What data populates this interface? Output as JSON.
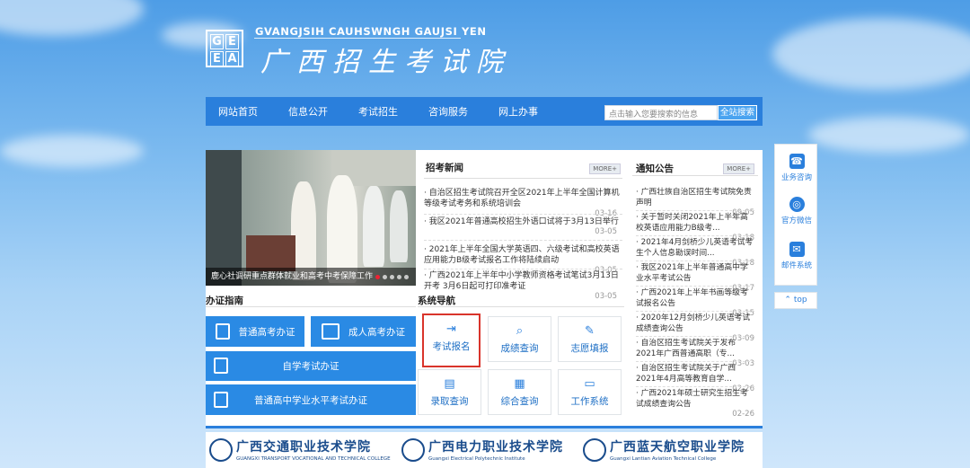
{
  "header": {
    "logo_letters": [
      "G",
      "E",
      "E",
      "A"
    ],
    "org_en": "GVANGJSIH CAUHSWNGH GAUJSI YEN",
    "org_cn": "广西招生考试院"
  },
  "nav": {
    "items": [
      "网站首页",
      "信息公开",
      "考试招生",
      "咨询服务",
      "网上办事"
    ],
    "search_placeholder": "点击输入您要搜索的信息",
    "search_button": "全站搜索"
  },
  "slider": {
    "caption": "鹿心社调研重点群体就业和高考中考保障工作"
  },
  "news": {
    "title": "招考新闻",
    "more": "MORE+",
    "items": [
      {
        "text": "自治区招生考试院召开全区2021年上半年全国计算机等级考试考务和系统培训会",
        "date": "03-16"
      },
      {
        "text": "我区2021年普通高校招生外语口试将于3月13日举行",
        "date": "03-05"
      },
      {
        "text": "2021年上半年全国大学英语四、六级考试和高校英语应用能力B级考试报名工作将陆续启动",
        "date": "03-05"
      },
      {
        "text": "广西2021年上半年中小学教师资格考试笔试3月13日开考 3月6日起可打印准考证",
        "date": "03-05"
      }
    ]
  },
  "guide": {
    "title": "办证指南",
    "buttons": [
      "普通高考办证",
      "成人高考办证",
      "自学考试办证",
      "普通高中学业水平考试办证"
    ]
  },
  "system_nav": {
    "title": "系统导航",
    "buttons": [
      "考试报名",
      "成绩查询",
      "志愿填报",
      "录取查询",
      "综合查询",
      "工作系统"
    ]
  },
  "notice": {
    "title": "通知公告",
    "more": "MORE+",
    "items": [
      {
        "text": "广西壮族自治区招生考试院免责声明",
        "date": "09-05"
      },
      {
        "text": "关于暂时关闭2021年上半年高校英语应用能力B级考...",
        "date": "03-18"
      },
      {
        "text": "2021年4月剑桥少儿英语考试考生个人信息勘误时间...",
        "date": "03-18"
      },
      {
        "text": "我区2021年上半年普通高中学业水平考试公告",
        "date": "03-17"
      },
      {
        "text": "广西2021年上半年书画等级考试报名公告",
        "date": "03-15"
      },
      {
        "text": "2020年12月剑桥少儿英语考试成绩查询公告",
        "date": "03-09"
      },
      {
        "text": "自治区招生考试院关于发布2021年广西普通高职（专...",
        "date": "03-03"
      },
      {
        "text": "自治区招生考试院关于广西2021年4月高等教育自学...",
        "date": "02-26"
      },
      {
        "text": "广西2021年硕士研究生招生考试成绩查询公告",
        "date": "02-26"
      }
    ]
  },
  "sidebar": {
    "items": [
      "业务咨询",
      "官方微信",
      "邮件系统"
    ],
    "top": "top"
  },
  "footer": {
    "logos": [
      {
        "cn": "广西交通职业技术学院",
        "en": "GUANGXI TRANSPORT VOCATIONAL AND TECHNICAL COLLEGE"
      },
      {
        "cn": "广西电力职业技术学院",
        "en": "Guangxi Electrical Polytechnic Institute"
      },
      {
        "cn": "广西蓝天航空职业学院",
        "en": "Guangxi Lantian Aviation Technical College"
      }
    ]
  },
  "colors": {
    "brand_blue": "#2a7fdc",
    "highlight_red": "#d9342b"
  }
}
